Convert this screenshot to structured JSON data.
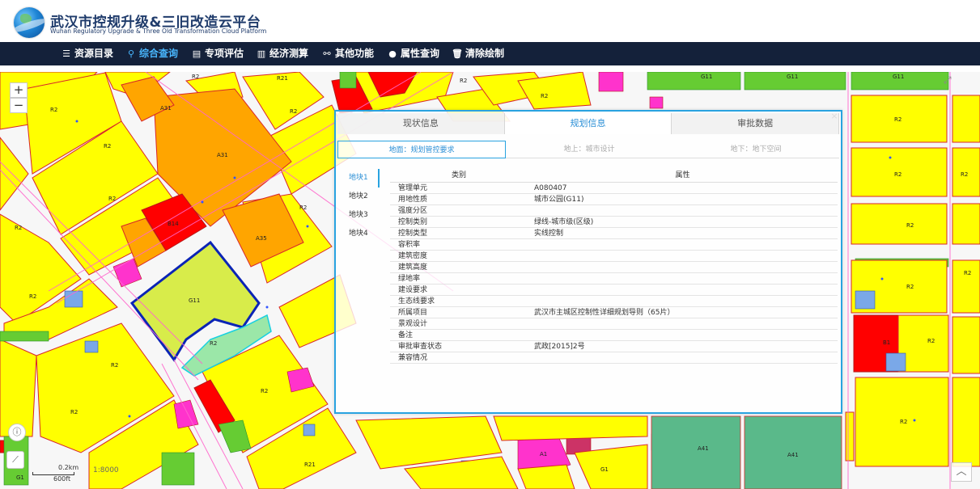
{
  "header": {
    "title": "武汉市控规升级&三旧改造云平台",
    "subtitle": "Wuhan Regulatory Upgrade & Three Old Transformation Cloud Platform"
  },
  "nav": [
    {
      "label": "资源目录",
      "icon": "list-icon"
    },
    {
      "label": "综合查询",
      "icon": "search-icon",
      "active": true
    },
    {
      "label": "专项评估",
      "icon": "document-icon"
    },
    {
      "label": "经济测算",
      "icon": "chart-icon"
    },
    {
      "label": "其他功能",
      "icon": "link-icon"
    },
    {
      "label": "属性查询",
      "icon": "circle-icon"
    },
    {
      "label": "清除绘制",
      "icon": "trash-icon"
    }
  ],
  "map": {
    "zoom_in": "+",
    "zoom_out": "−",
    "scale_km": "0.2km",
    "scale_ft": "600ft",
    "scale_ratio": "1:8000",
    "labels": {
      "r2": "R2",
      "r21": "R21",
      "a31": "A31",
      "a35": "A35",
      "b14": "B14",
      "g11": "G11",
      "b1": "B1",
      "a41": "A41",
      "a1": "A1",
      "g1": "G1"
    }
  },
  "panel": {
    "close": "×",
    "tabs": [
      "现状信息",
      "规划信息",
      "审批数据"
    ],
    "active_tab": 1,
    "subtabs": [
      "地面：规划管控要求",
      "地上：城市设计",
      "地下：地下空间"
    ],
    "parcels": [
      "地块1",
      "地块2",
      "地块3",
      "地块4"
    ],
    "columns": [
      "类别",
      "属性"
    ],
    "rows": [
      {
        "k": "管理单元",
        "v": "A080407"
      },
      {
        "k": "用地性质",
        "v": "城市公园(G11)"
      },
      {
        "k": "强度分区",
        "v": ""
      },
      {
        "k": "控制类别",
        "v": "绿线-城市级(区级)"
      },
      {
        "k": "控制类型",
        "v": "实线控制"
      },
      {
        "k": "容积率",
        "v": ""
      },
      {
        "k": "建筑密度",
        "v": ""
      },
      {
        "k": "建筑高度",
        "v": ""
      },
      {
        "k": "绿地率",
        "v": ""
      },
      {
        "k": "建设要求",
        "v": ""
      },
      {
        "k": "生态线要求",
        "v": ""
      },
      {
        "k": "所属项目",
        "v": "武汉市主城区控制性详细规划导则（65片）"
      },
      {
        "k": "景观设计",
        "v": ""
      },
      {
        "k": "备注",
        "v": ""
      },
      {
        "k": "审批审查状态",
        "v": "武政[2015]2号"
      },
      {
        "k": "兼容情况",
        "v": ""
      }
    ]
  },
  "colors": {
    "nav_bg": "#14213a",
    "accent": "#2b8fd6",
    "residential": "#ffff00",
    "commercial": "#ff0000",
    "public": "#ffa500",
    "green": "#66cc33"
  }
}
